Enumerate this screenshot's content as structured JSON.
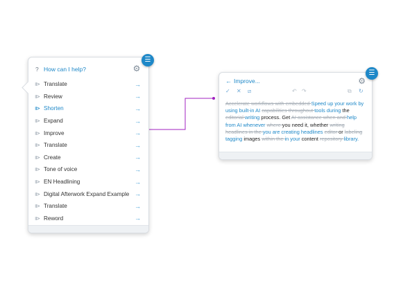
{
  "menu": {
    "help_prompt": "How can I help?",
    "help_icon": "question-icon",
    "settings_icon": "gear-icon",
    "items": [
      {
        "label": "Translate",
        "active": false
      },
      {
        "label": "Review",
        "active": false
      },
      {
        "label": "Shorten",
        "active": true
      },
      {
        "label": "Expand",
        "active": false
      },
      {
        "label": "Improve",
        "active": false
      },
      {
        "label": "Translate",
        "active": false
      },
      {
        "label": "Create",
        "active": false
      },
      {
        "label": "Tone of voice",
        "active": false
      },
      {
        "label": "EN Headlining",
        "active": false
      },
      {
        "label": "Digital Afterwork Expand Example",
        "active": false
      },
      {
        "label": "Translate",
        "active": false
      },
      {
        "label": "Reword",
        "active": false
      }
    ]
  },
  "improve": {
    "title": "Improve...",
    "segments": [
      {
        "t": "Accelerate workflows with embedded ",
        "k": "del"
      },
      {
        "t": "Speed up your work by using built-in AI ",
        "k": "ins"
      },
      {
        "t": "capabilities throughout ",
        "k": "del"
      },
      {
        "t": "tools during ",
        "k": "ins"
      },
      {
        "t": "the ",
        "k": "plain"
      },
      {
        "t": "editorial ",
        "k": "del"
      },
      {
        "t": "writing ",
        "k": "ins"
      },
      {
        "t": "process. Get ",
        "k": "plain"
      },
      {
        "t": "AI assistance when and ",
        "k": "del"
      },
      {
        "t": "help from AI whenever ",
        "k": "ins"
      },
      {
        "t": "where ",
        "k": "del"
      },
      {
        "t": "you need it, whether ",
        "k": "plain"
      },
      {
        "t": "writing headlines in the ",
        "k": "del"
      },
      {
        "t": "you are creating headlines ",
        "k": "ins"
      },
      {
        "t": "editor ",
        "k": "del"
      },
      {
        "t": "or ",
        "k": "plain"
      },
      {
        "t": "labeling ",
        "k": "del"
      },
      {
        "t": "tagging ",
        "k": "ins"
      },
      {
        "t": "images ",
        "k": "plain"
      },
      {
        "t": "within the ",
        "k": "del"
      },
      {
        "t": "in your ",
        "k": "ins"
      },
      {
        "t": "content ",
        "k": "plain"
      },
      {
        "t": "repository ",
        "k": "del"
      },
      {
        "t": "library.",
        "k": "ins"
      }
    ]
  },
  "colors": {
    "accent": "#1e88c8",
    "connector": "#a020c0"
  }
}
